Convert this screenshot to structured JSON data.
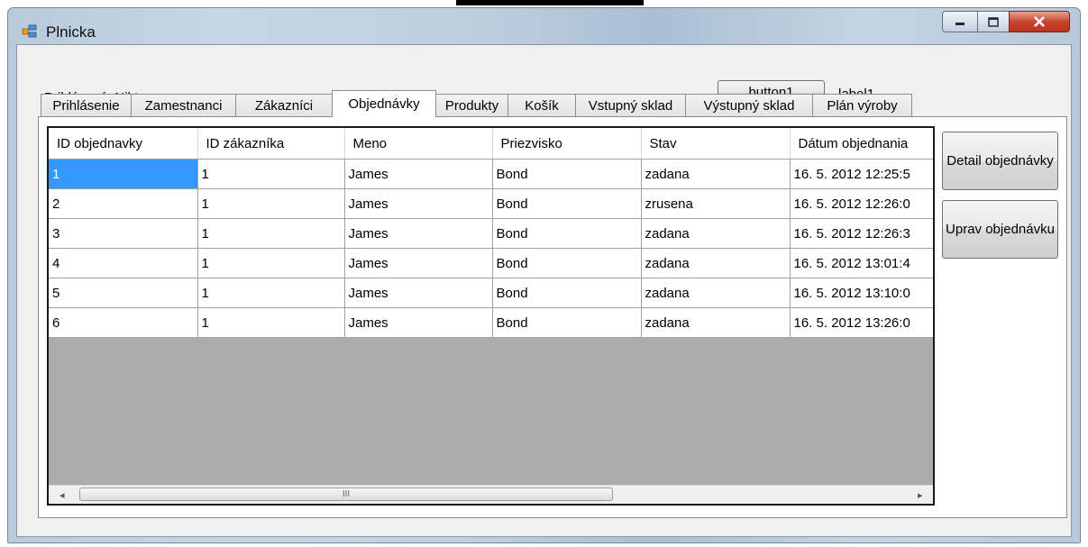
{
  "window": {
    "title": "Plnicka"
  },
  "header": {
    "logged_label": "Prihlásený: Nikto",
    "button1": "button1",
    "label1": "label1"
  },
  "tabs": [
    {
      "label": "Prihlásenie"
    },
    {
      "label": "Zamestnanci"
    },
    {
      "label": "Zákazníci"
    },
    {
      "label": "Objednávky"
    },
    {
      "label": "Produkty"
    },
    {
      "label": "Košík"
    },
    {
      "label": "Vstupný sklad"
    },
    {
      "label": "Výstupný sklad"
    },
    {
      "label": "Plán výroby"
    }
  ],
  "active_tab": "Objednávky",
  "grid": {
    "columns": [
      "ID objednavky",
      "ID zákazníka",
      "Meno",
      "Priezvisko",
      "Stav",
      "Dátum objednania"
    ],
    "rows": [
      [
        "1",
        "1",
        "James",
        "Bond",
        "zadana",
        "16. 5. 2012 12:25:5"
      ],
      [
        "2",
        "1",
        "James",
        "Bond",
        "zrusena",
        "16. 5. 2012 12:26:0"
      ],
      [
        "3",
        "1",
        "James",
        "Bond",
        "zadana",
        "16. 5. 2012 12:26:3"
      ],
      [
        "4",
        "1",
        "James",
        "Bond",
        "zadana",
        "16. 5. 2012 13:01:4"
      ],
      [
        "5",
        "1",
        "James",
        "Bond",
        "zadana",
        "16. 5. 2012 13:10:0"
      ],
      [
        "6",
        "1",
        "James",
        "Bond",
        "zadana",
        "16. 5. 2012 13:26:0"
      ]
    ],
    "scroll_arrow_left": "◂",
    "scroll_arrow_right": "▸",
    "scroll_grip": "III"
  },
  "side_buttons": {
    "detail": "Detail objednávky",
    "edit": "Uprav objednávku"
  },
  "colors": {
    "selection": "#3399ff",
    "close_button": "#c9462d"
  }
}
